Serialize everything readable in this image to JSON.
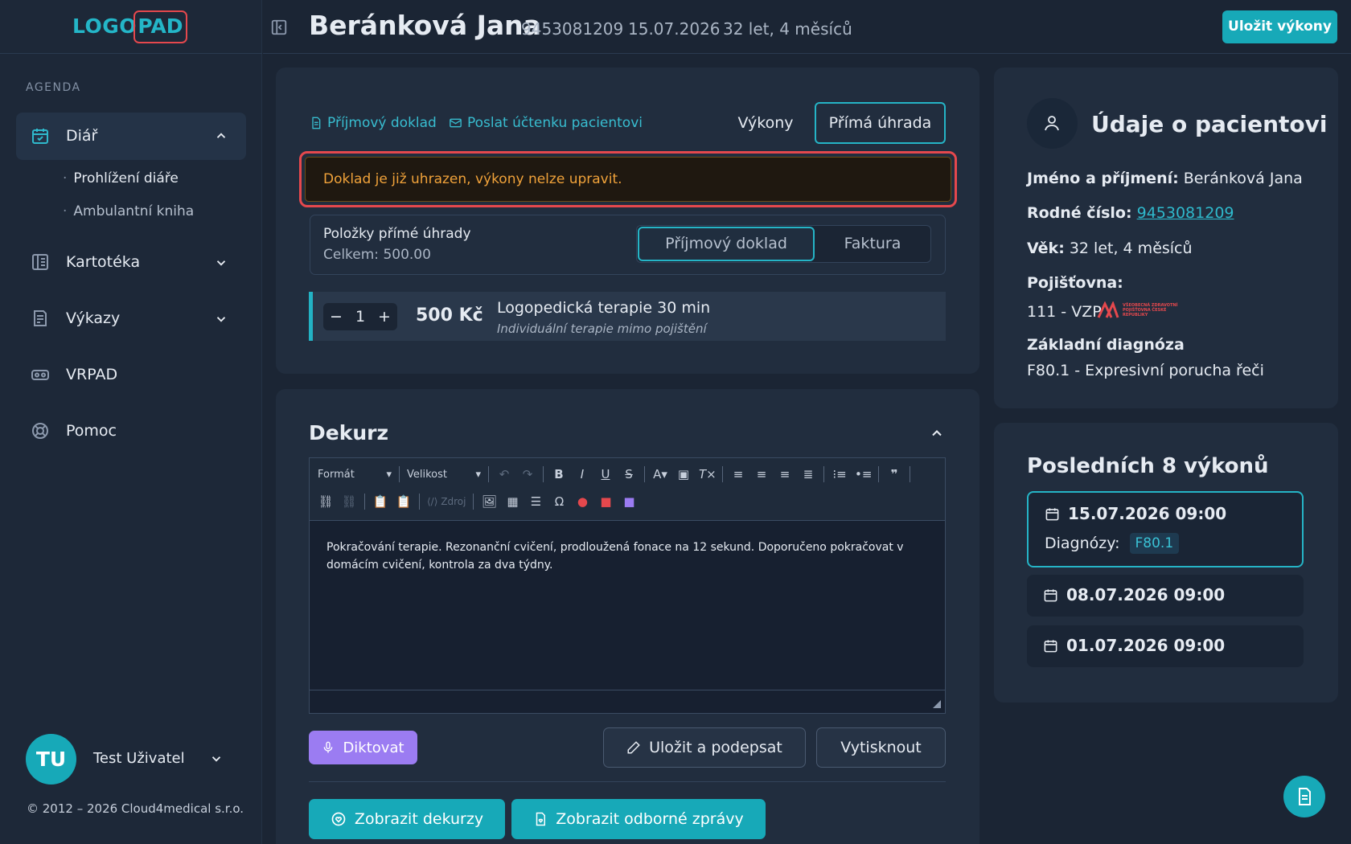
{
  "app": {
    "logo_left": "LOGO",
    "logo_right": "PAD"
  },
  "sidebar": {
    "section": "AGENDA",
    "items": [
      {
        "label": "Diář",
        "icon": "calendar-check-icon"
      },
      {
        "label": "Kartotéka",
        "icon": "book-icon"
      },
      {
        "label": "Výkazy",
        "icon": "report-icon"
      },
      {
        "label": "VRPAD",
        "icon": "vr-headset-icon"
      },
      {
        "label": "Pomoc",
        "icon": "lifebuoy-icon"
      }
    ],
    "subitems": [
      "Prohlížení diáře",
      "Ambulantní kniha"
    ],
    "user": {
      "initials": "TU",
      "name": "Test Uživatel"
    },
    "copyright": "© 2012 – 2026 Cloud4medical s.r.o."
  },
  "header": {
    "name": "Beránková Jana",
    "id": "9453081209",
    "date": "15.07.2026",
    "age": "32 let, 4 měsíců",
    "save_label": "Uložit výkony"
  },
  "payment": {
    "link_receipt": "Příjmový doklad",
    "link_send": "Poslat účtenku pacientovi",
    "tab_services": "Výkony",
    "tab_direct": "Přímá úhrada",
    "alert": "Doklad je již uhrazen, výkony nelze upravit.",
    "items_title": "Položky přímé úhrady",
    "items_total": "Celkem: 500.00",
    "seg_receipt": "Příjmový doklad",
    "seg_invoice": "Faktura",
    "row": {
      "qty": "1",
      "price": "500 Kč",
      "title": "Logopedická terapie 30 min",
      "subtitle": "Individuální terapie mimo pojištění"
    }
  },
  "dekurz": {
    "title": "Dekurz",
    "format": "Formát",
    "size": "Velikost",
    "source": "Zdroj",
    "text": "Pokračování terapie. Rezonanční cvičení, prodloužená fonace na 12 sekund. Doporučeno pokračovat v domácím cvičení, kontrola za dva týdny.",
    "dictate": "Diktovat",
    "save_sign": "Uložit a podepsat",
    "print": "Vytisknout",
    "show_dekurz": "Zobrazit dekurzy",
    "show_reports": "Zobrazit odborné zprávy"
  },
  "patient": {
    "title": "Údaje o pacientovi",
    "name_label": "Jméno a příjmení:",
    "name_value": "Beránková Jana",
    "rc_label": "Rodné číslo:",
    "rc_value": "9453081209",
    "age_label": "Věk:",
    "age_value": "32 let, 4 měsíců",
    "ins_label": "Pojišťovna:",
    "ins_value": "111 - VZP",
    "ins_logo_text": "VŠEOBECNÁ ZDRAVOTNÍ POJIŠŤOVNA ČESKÉ REPUBLIKY",
    "diag_label": "Základní diagnóza",
    "diag_value": "F80.1 - Expresivní porucha řeči"
  },
  "history": {
    "title": "Posledních 8 výkonů",
    "diag_label": "Diagnózy:",
    "entries": [
      {
        "date": "15.07.2026 09:00",
        "diag": "F80.1"
      },
      {
        "date": "08.07.2026 09:00"
      },
      {
        "date": "01.07.2026 09:00"
      }
    ]
  },
  "colors": {
    "accent": "#17a9b8",
    "alert": "#f0a23a",
    "danger": "#e5484d",
    "purple": "#9b7cf2"
  }
}
